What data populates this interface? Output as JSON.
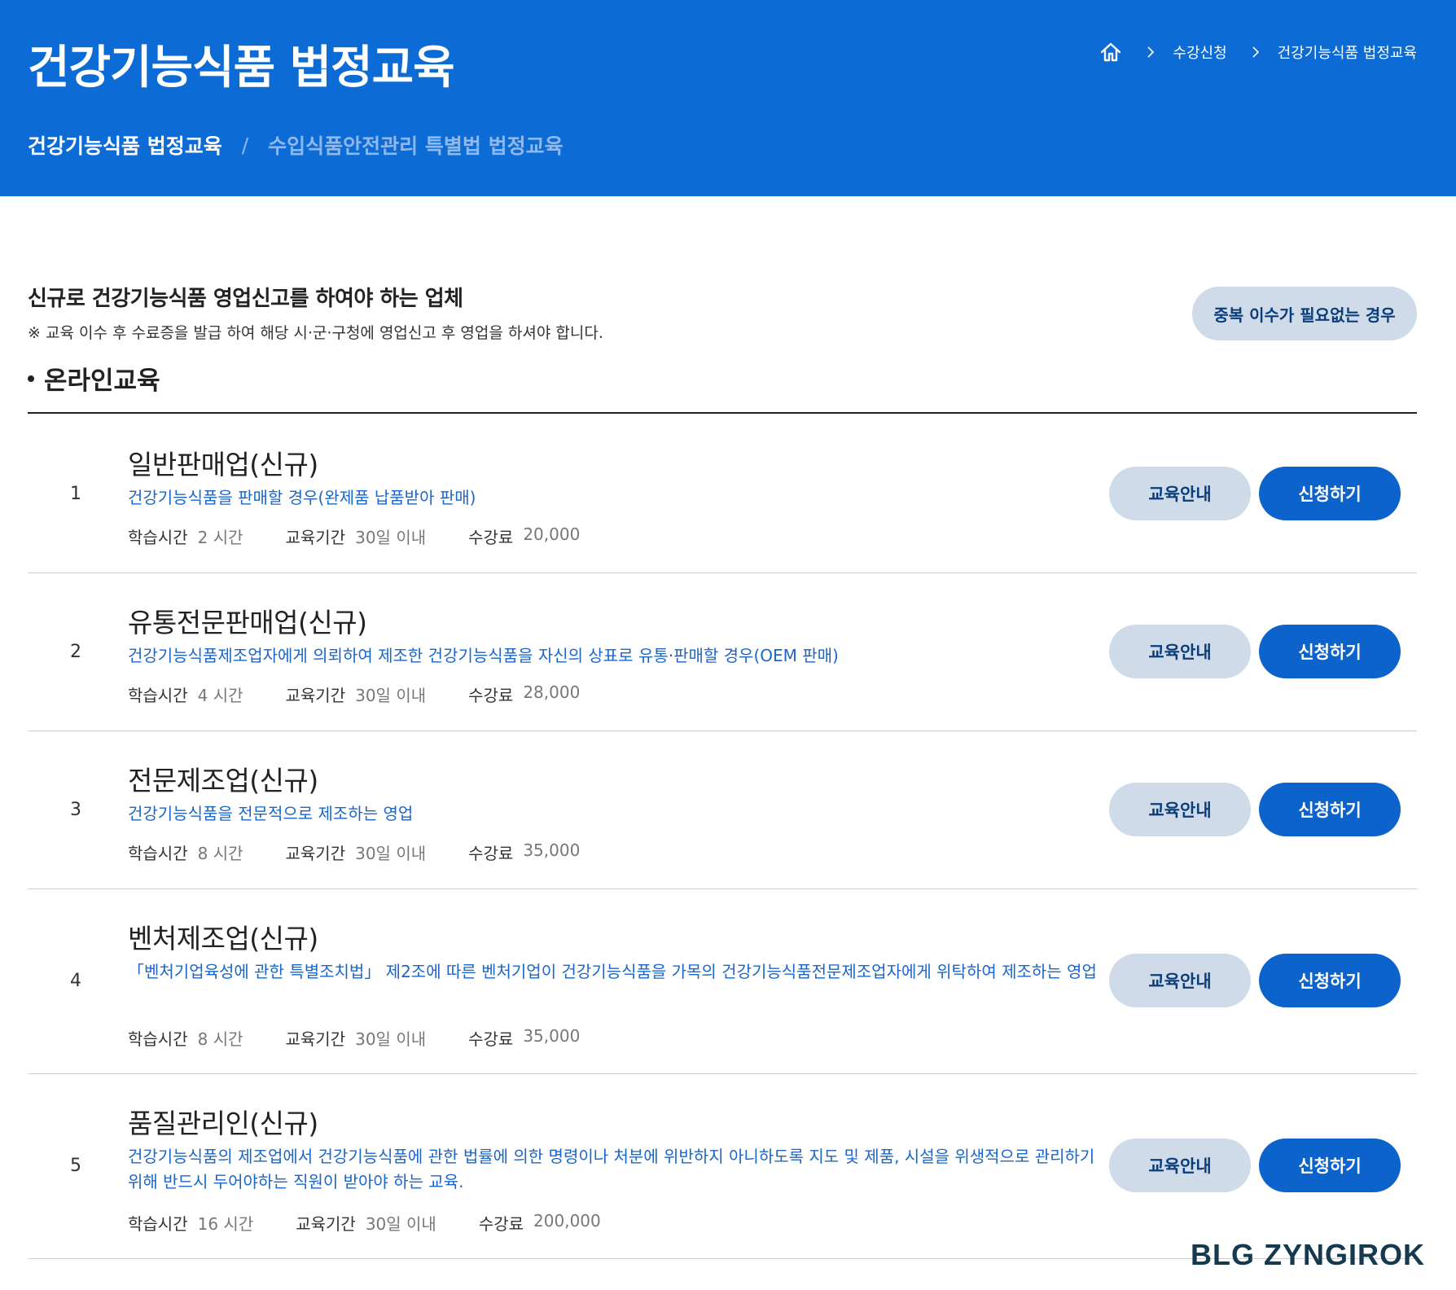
{
  "header": {
    "title": "건강기능식품 법정교육",
    "breadcrumb": {
      "home_icon": "home-icon",
      "separator_icon": "chevron-right-icon",
      "items": [
        "수강신청",
        "건강기능식품 법정교육"
      ]
    },
    "tabs": [
      {
        "label": "건강기능식품 법정교육",
        "active": true
      },
      {
        "label": "수입식품안전관리 특별법 법정교육",
        "active": false
      }
    ],
    "tab_separator": "/"
  },
  "section": {
    "title": "신규로 건강기능식품 영업신고를 하여야 하는 업체",
    "note": "※ 교육 이수 후 수료증을 발급 하여 해당 시·군·구청에 영업신고 후 영업을 하셔야 합니다.",
    "duplicate_button": "중복 이수가 필요없는 경우",
    "online_heading": "온라인교육"
  },
  "labels": {
    "study_time": "학습시간",
    "period": "교육기간",
    "fee": "수강료",
    "info_button": "교육안내",
    "apply_button": "신청하기"
  },
  "courses": [
    {
      "no": "1",
      "name": "일반판매업(신규)",
      "desc": "건강기능식품을 판매할 경우(완제품 납품받아 판매)",
      "time": "2 시간",
      "period": "30일 이내",
      "fee": "20,000"
    },
    {
      "no": "2",
      "name": "유통전문판매업(신규)",
      "desc": "건강기능식품제조업자에게 의뢰하여 제조한 건강기능식품을 자신의 상표로 유통·판매할 경우(OEM 판매)",
      "time": "4 시간",
      "period": "30일 이내",
      "fee": "28,000"
    },
    {
      "no": "3",
      "name": "전문제조업(신규)",
      "desc": "건강기능식품을 전문적으로 제조하는 영업",
      "time": "8 시간",
      "period": "30일 이내",
      "fee": "35,000"
    },
    {
      "no": "4",
      "name": "벤처제조업(신규)",
      "desc": "「벤처기업육성에 관한 특별조치법」 제2조에 따른 벤처기업이 건강기능식품을 가목의 건강기능식품전문제조업자에게 위탁하여 제조하는 영업",
      "time": "8 시간",
      "period": "30일 이내",
      "fee": "35,000"
    },
    {
      "no": "5",
      "name": "품질관리인(신규)",
      "desc": "건강기능식품의 제조업에서 건강기능식품에 관한 법률에 의한 명령이나 처분에 위반하지 아니하도록 지도 및 제품, 시설을 위생적으로 관리하기 위해 반드시 두어야하는 직원이 받아야 하는 교육.",
      "time": "16 시간",
      "period": "30일 이내",
      "fee": "200,000"
    }
  ],
  "watermark": "BLG ZYNGIROK",
  "colors": {
    "header_bg": "#0d6bd5",
    "tab_inactive": "#8fb8ec",
    "desc_text": "#1a66c9",
    "apply_button": "#0d63cc",
    "info_button": "#cfdbe8",
    "info_button_text": "#0b3d7a"
  }
}
